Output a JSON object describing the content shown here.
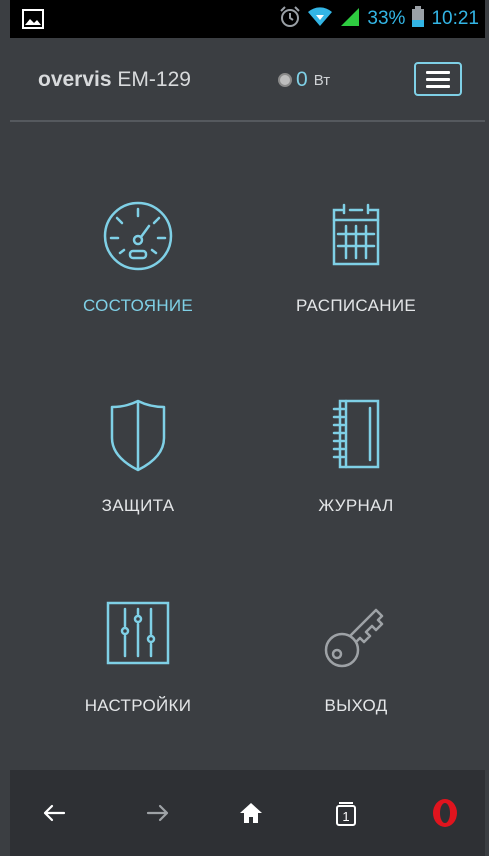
{
  "statusbar": {
    "battery": "33%",
    "time": "10:21",
    "icons": [
      "gallery-icon",
      "alarm-icon",
      "wifi-icon",
      "signal-icon",
      "battery-icon"
    ]
  },
  "header": {
    "brand": "overvis",
    "model": "EM-129",
    "power_value": "0",
    "power_unit": "Вт"
  },
  "tiles": [
    {
      "label": "СОСТОЯНИЕ",
      "icon": "gauge-icon",
      "active": true
    },
    {
      "label": "РАСПИСАНИЕ",
      "icon": "calendar-icon",
      "active": false
    },
    {
      "label": "ЗАЩИТА",
      "icon": "shield-icon",
      "active": false
    },
    {
      "label": "ЖУРНАЛ",
      "icon": "journal-icon",
      "active": false
    },
    {
      "label": "НАСТРОЙКИ",
      "icon": "sliders-icon",
      "active": false
    },
    {
      "label": "ВЫХОД",
      "icon": "key-icon",
      "active": false
    }
  ],
  "navbar": {
    "tab_count": "1",
    "icons": [
      "back-arrow-icon",
      "forward-arrow-icon",
      "home-icon",
      "tabs-icon",
      "opera-icon"
    ]
  },
  "colors": {
    "background": "#3b3e42",
    "accent": "#7fd0e6",
    "statusbar_text": "#33b5e5",
    "navbar": "#2e3034",
    "opera_red": "#e0141e"
  }
}
